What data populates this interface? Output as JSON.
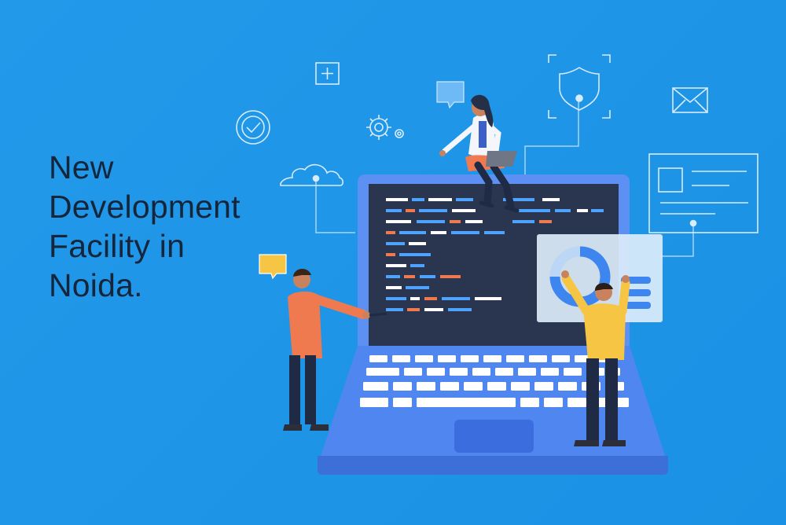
{
  "headline": {
    "lines": [
      "New",
      "Development",
      "Facility in",
      "Noida."
    ]
  },
  "colors": {
    "background": "#1e95e8",
    "headline_text": "#15253a",
    "laptop_frame": "#5b8ff2",
    "screen": "#27324a",
    "accent_orange": "#ef7a4f",
    "accent_yellow": "#f6c544"
  },
  "icons": [
    "plus-icon",
    "chat-bubble-icon",
    "gear-icon",
    "checkmark-circle-icon",
    "shield-icon",
    "mail-icon",
    "cloud-icon",
    "browser-window-icon",
    "donut-chart-icon"
  ]
}
